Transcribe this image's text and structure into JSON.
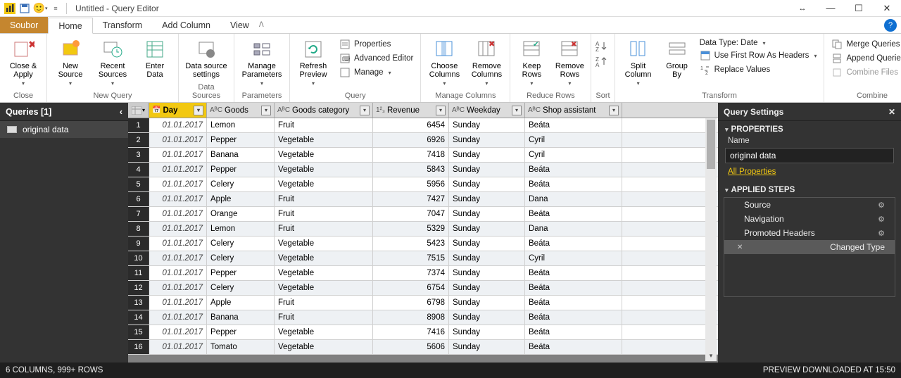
{
  "titlebar": {
    "title": "Untitled - Query Editor"
  },
  "menubar": {
    "file": "Soubor",
    "home": "Home",
    "transform": "Transform",
    "add_column": "Add Column",
    "view": "View"
  },
  "ribbon": {
    "close": {
      "btn": "Close &\nApply",
      "group": "Close"
    },
    "newquery": {
      "new_source": "New\nSource",
      "recent_sources": "Recent\nSources",
      "enter_data": "Enter\nData",
      "group": "New Query"
    },
    "datasources": {
      "settings": "Data source\nsettings",
      "group": "Data Sources"
    },
    "parameters": {
      "manage": "Manage\nParameters",
      "group": "Parameters"
    },
    "query": {
      "refresh": "Refresh\nPreview",
      "properties": "Properties",
      "advanced": "Advanced Editor",
      "manage": "Manage",
      "group": "Query"
    },
    "columns": {
      "choose": "Choose\nColumns",
      "remove": "Remove\nColumns",
      "group": "Manage Columns"
    },
    "rows": {
      "keep": "Keep\nRows",
      "remove": "Remove\nRows",
      "group": "Reduce Rows"
    },
    "sort": {
      "group": "Sort"
    },
    "transform": {
      "split": "Split\nColumn",
      "groupby": "Group\nBy",
      "datatype": "Data Type: Date",
      "first_row": "Use First Row As Headers",
      "replace": "Replace Values",
      "group": "Transform"
    },
    "combine": {
      "merge": "Merge Queries",
      "append": "Append Queries",
      "files": "Combine Files",
      "group": "Combine"
    }
  },
  "queries": {
    "title": "Queries [1]",
    "item": "original data"
  },
  "grid": {
    "headers": {
      "day": "Day",
      "goods": "Goods",
      "category": "Goods category",
      "revenue": "Revenue",
      "weekday": "Weekday",
      "assistant": "Shop assistant"
    },
    "rows": [
      {
        "n": 1,
        "day": "01.01.2017",
        "goods": "Lemon",
        "cat": "Fruit",
        "rev": "6454",
        "wk": "Sunday",
        "sa": "Beáta"
      },
      {
        "n": 2,
        "day": "01.01.2017",
        "goods": "Pepper",
        "cat": "Vegetable",
        "rev": "6926",
        "wk": "Sunday",
        "sa": "Cyril"
      },
      {
        "n": 3,
        "day": "01.01.2017",
        "goods": "Banana",
        "cat": "Vegetable",
        "rev": "7418",
        "wk": "Sunday",
        "sa": "Cyril"
      },
      {
        "n": 4,
        "day": "01.01.2017",
        "goods": "Pepper",
        "cat": "Vegetable",
        "rev": "5843",
        "wk": "Sunday",
        "sa": "Beáta"
      },
      {
        "n": 5,
        "day": "01.01.2017",
        "goods": "Celery",
        "cat": "Vegetable",
        "rev": "5956",
        "wk": "Sunday",
        "sa": "Beáta"
      },
      {
        "n": 6,
        "day": "01.01.2017",
        "goods": "Apple",
        "cat": "Fruit",
        "rev": "7427",
        "wk": "Sunday",
        "sa": "Dana"
      },
      {
        "n": 7,
        "day": "01.01.2017",
        "goods": "Orange",
        "cat": "Fruit",
        "rev": "7047",
        "wk": "Sunday",
        "sa": "Beáta"
      },
      {
        "n": 8,
        "day": "01.01.2017",
        "goods": "Lemon",
        "cat": "Fruit",
        "rev": "5329",
        "wk": "Sunday",
        "sa": "Dana"
      },
      {
        "n": 9,
        "day": "01.01.2017",
        "goods": "Celery",
        "cat": "Vegetable",
        "rev": "5423",
        "wk": "Sunday",
        "sa": "Beáta"
      },
      {
        "n": 10,
        "day": "01.01.2017",
        "goods": "Celery",
        "cat": "Vegetable",
        "rev": "7515",
        "wk": "Sunday",
        "sa": "Cyril"
      },
      {
        "n": 11,
        "day": "01.01.2017",
        "goods": "Pepper",
        "cat": "Vegetable",
        "rev": "7374",
        "wk": "Sunday",
        "sa": "Beáta"
      },
      {
        "n": 12,
        "day": "01.01.2017",
        "goods": "Celery",
        "cat": "Vegetable",
        "rev": "6754",
        "wk": "Sunday",
        "sa": "Beáta"
      },
      {
        "n": 13,
        "day": "01.01.2017",
        "goods": "Apple",
        "cat": "Fruit",
        "rev": "6798",
        "wk": "Sunday",
        "sa": "Beáta"
      },
      {
        "n": 14,
        "day": "01.01.2017",
        "goods": "Banana",
        "cat": "Fruit",
        "rev": "8908",
        "wk": "Sunday",
        "sa": "Beáta"
      },
      {
        "n": 15,
        "day": "01.01.2017",
        "goods": "Pepper",
        "cat": "Vegetable",
        "rev": "7416",
        "wk": "Sunday",
        "sa": "Beáta"
      },
      {
        "n": 16,
        "day": "01.01.2017",
        "goods": "Tomato",
        "cat": "Vegetable",
        "rev": "5606",
        "wk": "Sunday",
        "sa": "Beáta"
      }
    ]
  },
  "settings": {
    "title": "Query Settings",
    "properties": "PROPERTIES",
    "name_label": "Name",
    "name_value": "original data",
    "all_props": "All Properties",
    "applied": "APPLIED STEPS",
    "steps": {
      "source": "Source",
      "nav": "Navigation",
      "promoted": "Promoted Headers",
      "changed": "Changed Type"
    }
  },
  "status": {
    "left": "6 COLUMNS, 999+ ROWS",
    "right": "PREVIEW DOWNLOADED AT 15:50"
  }
}
